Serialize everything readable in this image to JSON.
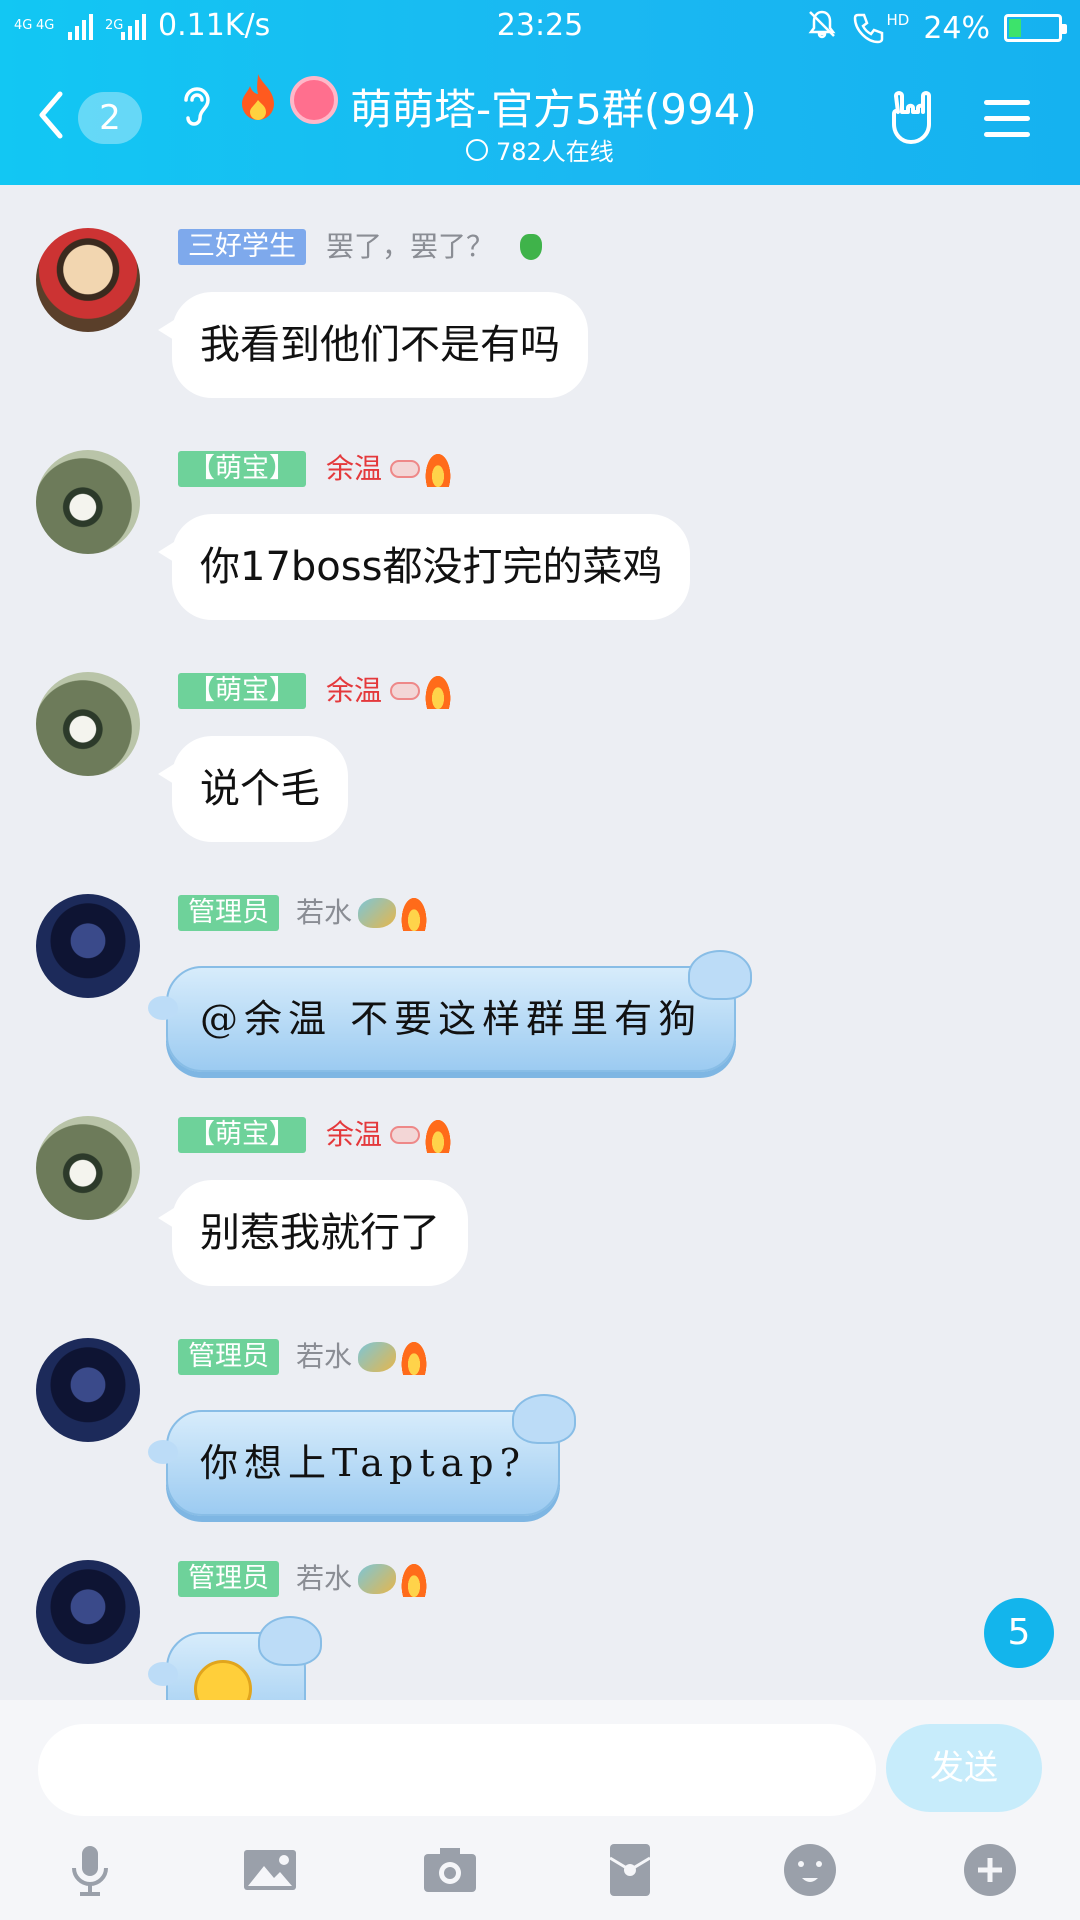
{
  "status_bar": {
    "network_left": "4G",
    "network_mid": "4G",
    "network_third": "2G",
    "speed": "0.11K/s",
    "time": "23:25",
    "hd_label": "HD",
    "battery": "24%",
    "battery_level": 0.24
  },
  "header": {
    "back_count": "2",
    "title": "萌萌塔-官方5群(994)",
    "online": "782人在线"
  },
  "messages": [
    {
      "tag": "三好学生",
      "nick": "罢了，罢了？",
      "text": "我看到他们不是有吗"
    },
    {
      "tag": "【萌宝】",
      "nick": "余温",
      "text": "你17boss都没打完的菜鸡"
    },
    {
      "tag": "【萌宝】",
      "nick": "余温",
      "text": "说个毛"
    },
    {
      "tag": "管理员",
      "nick": "若水",
      "text": "@余温  不要这样群里有狗"
    },
    {
      "tag": "【萌宝】",
      "nick": "余温",
      "text": "别惹我就行了"
    },
    {
      "tag": "管理员",
      "nick": "若水",
      "text": "你想上Taptap?"
    },
    {
      "tag": "管理员",
      "nick": "若水",
      "text": ""
    }
  ],
  "unread_count": "5",
  "input": {
    "placeholder": "",
    "send_label": "发送"
  },
  "colors": {
    "header": "#15b8f1",
    "tag_green": "#6ed29a",
    "tag_blue": "#7ea9ec",
    "nick_red": "#e4393c",
    "send_disabled": "#c7ecfb"
  }
}
